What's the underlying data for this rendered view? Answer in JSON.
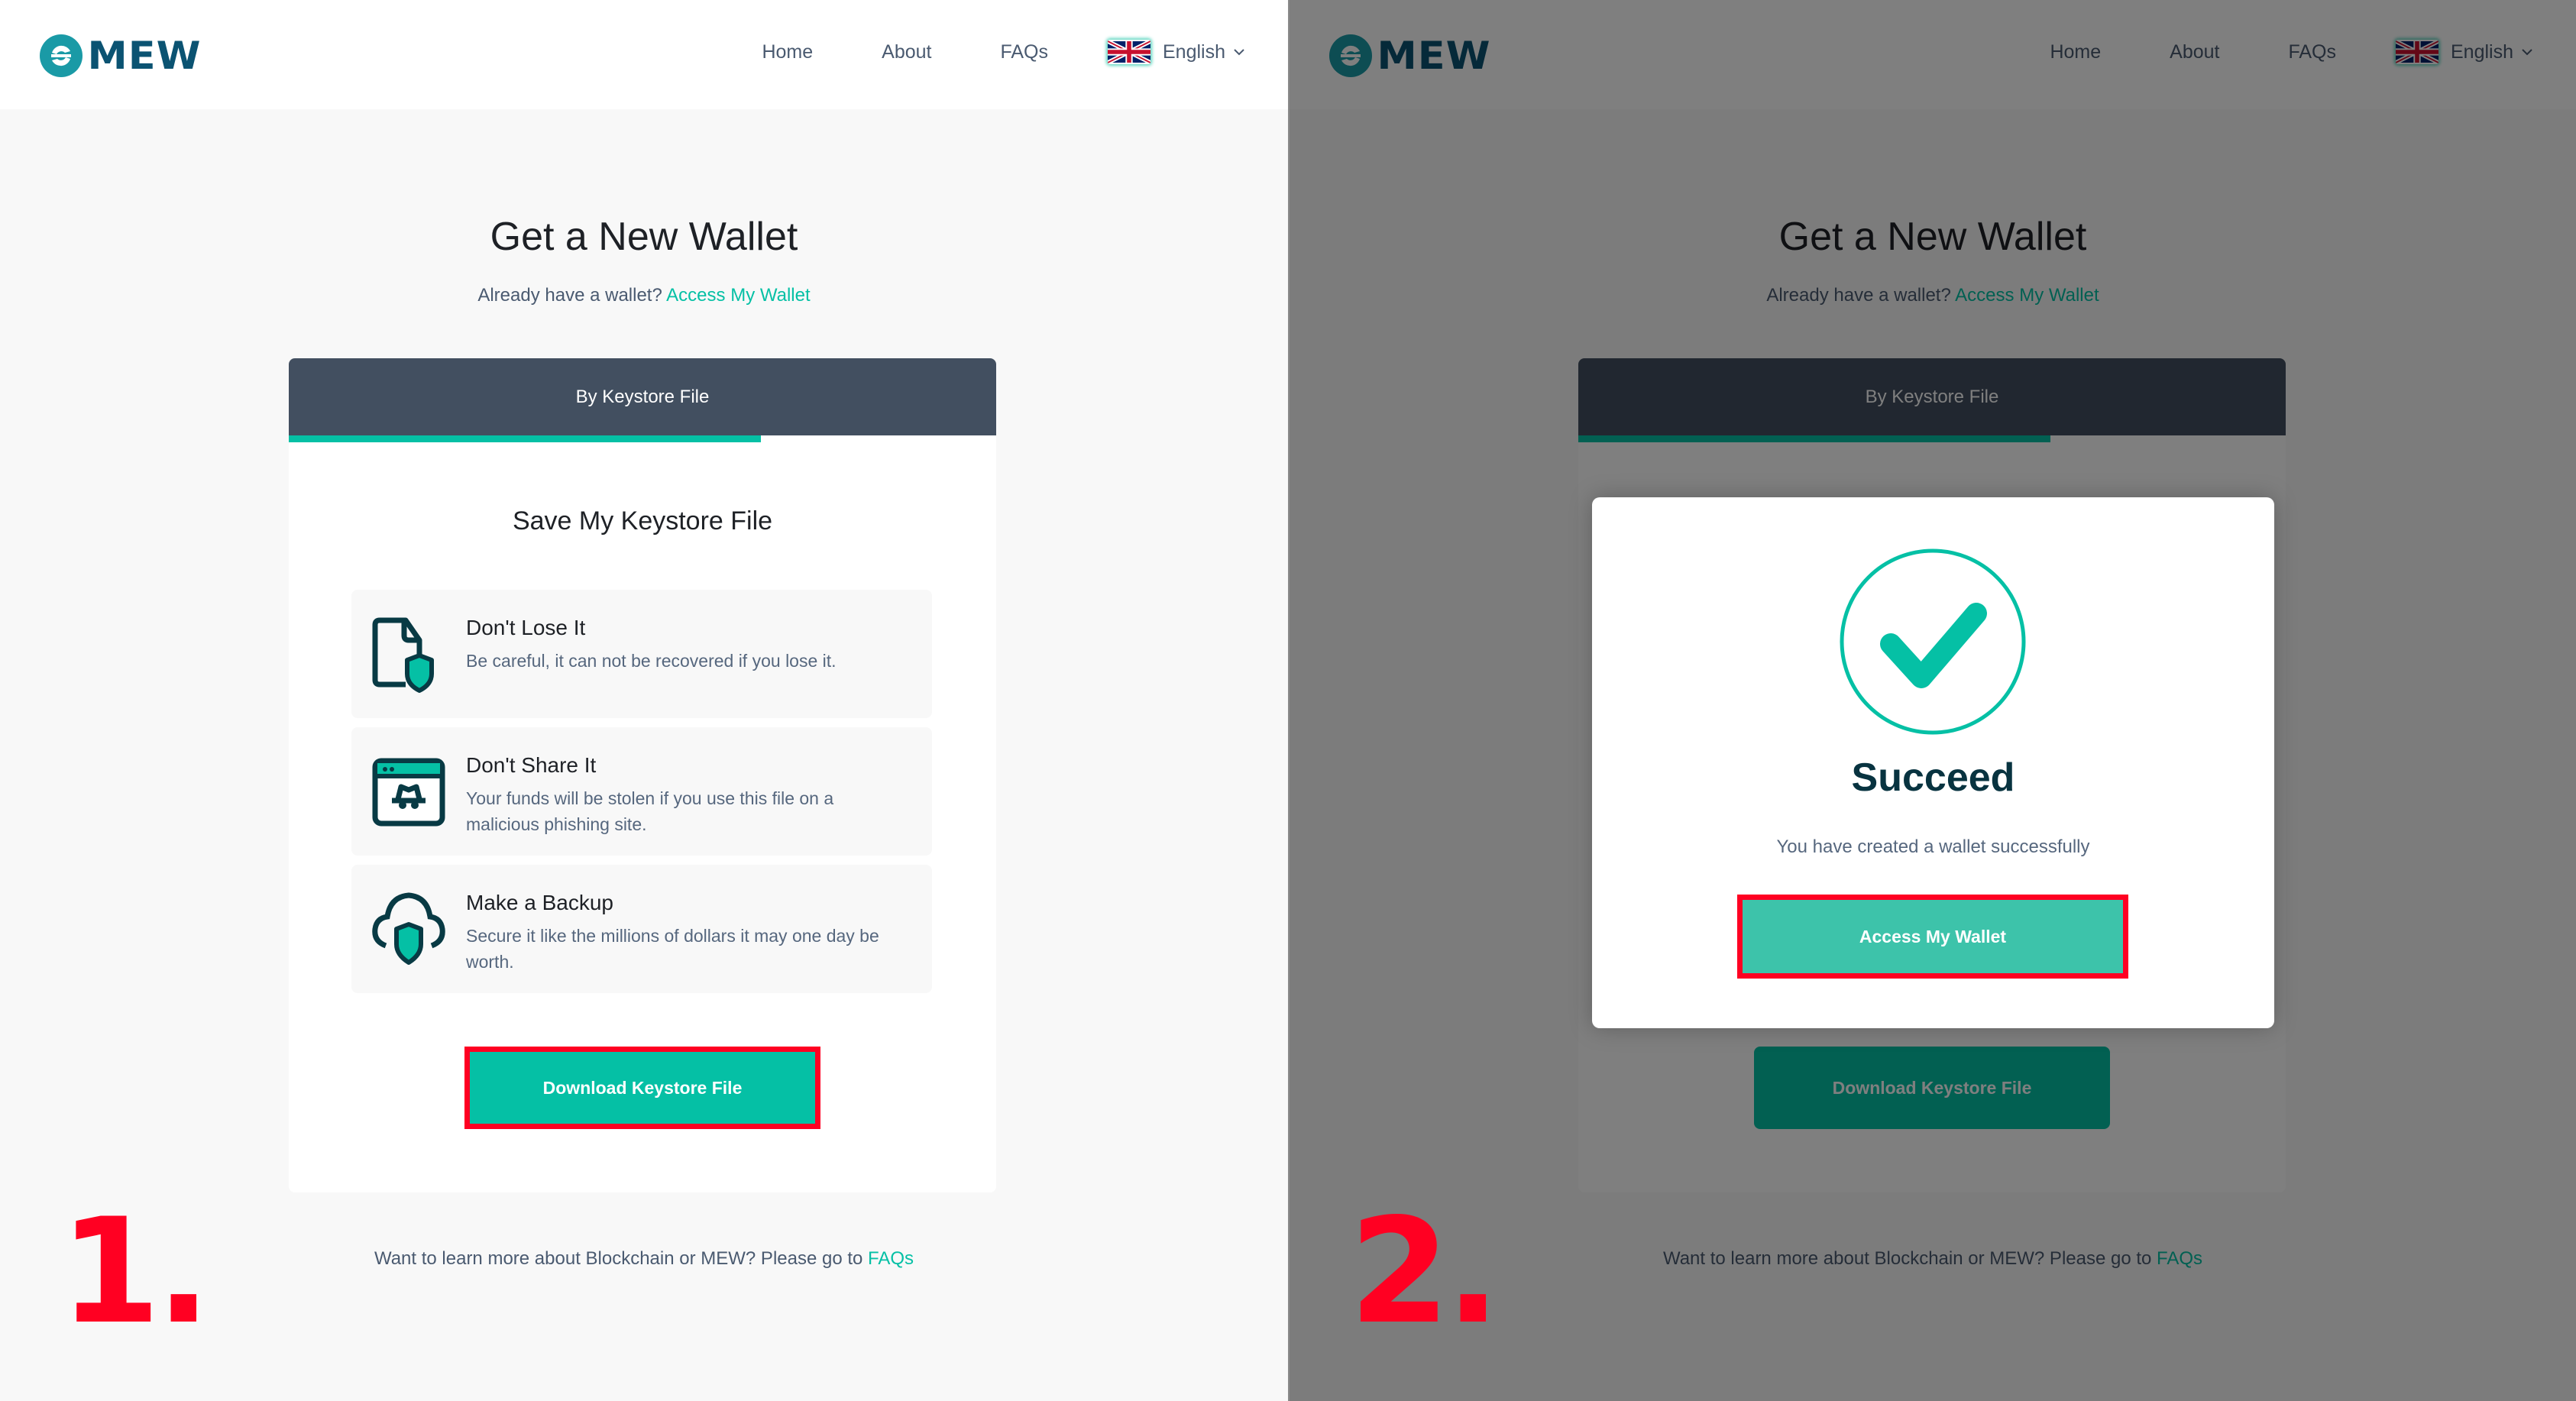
{
  "brand": {
    "name": "MEW",
    "accent": "#05c0a5",
    "logo_color": "#0b5372",
    "annotation_color": "#ff0022"
  },
  "nav": {
    "items": [
      "Home",
      "About",
      "FAQs"
    ],
    "language": "English",
    "language_flag": "uk-flag-icon"
  },
  "page": {
    "title": "Get a New Wallet",
    "subtitle_prefix": "Already have a wallet?",
    "subtitle_link": "Access My Wallet"
  },
  "card": {
    "tab_label": "By Keystore File",
    "progress_fraction": 0.667,
    "heading": "Save My Keystore File",
    "items": [
      {
        "icon": "file-shield-icon",
        "title": "Don't Lose It",
        "desc": "Be careful, it can not be recovered if you lose it."
      },
      {
        "icon": "phishing-browser-icon",
        "title": "Don't Share It",
        "desc": "Your funds will be stolen if you use this file on a malicious phishing site."
      },
      {
        "icon": "cloud-shield-icon",
        "title": "Make a Backup",
        "desc": "Secure it like the millions of dollars it may one day be worth."
      }
    ],
    "download_button": "Download Keystore File"
  },
  "footer": {
    "text": "Want to learn more about Blockchain or MEW? Please go to",
    "link": "FAQs"
  },
  "modal": {
    "icon": "checkmark-circle-icon",
    "title": "Succeed",
    "message": "You have created a wallet successfully",
    "button": "Access My Wallet"
  },
  "step_labels": [
    "1.",
    "2."
  ]
}
